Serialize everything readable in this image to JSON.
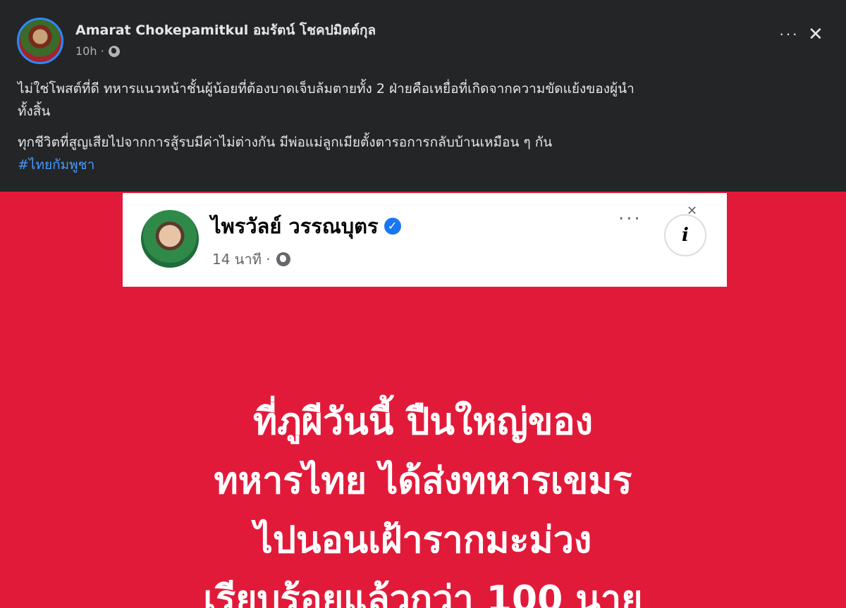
{
  "post": {
    "author": "Amarat Chokepamitkul อมรัตน์ โชคปมิตต์กุล",
    "time": "10h ·",
    "text_line1": "ไม่ใช่โพสต์ที่ดี ทหารแนวหน้าชั้นผู้น้อยที่ต้องบาดเจ็บล้มตายทั้ง 2 ฝ่ายคือเหยื่อที่เกิดจากความขัดแย้งของผู้นำ",
    "text_line2": "ทั้งสิ้น",
    "text_line3": "ทุกชีวิตที่สูญเสียไปจากการสู้รบมีค่าไม่ต่างกัน มีพ่อแม่ลูกเมียตั้งตารอการกลับบ้านเหมือน ๆ กัน",
    "hashtag": "#ไทยกัมพูชา",
    "more_label": "···",
    "close_label": "✕"
  },
  "quoted": {
    "author": "ไพรวัลย์ วรรณบุตร",
    "time": "14 นาที ·",
    "more_label": "···",
    "info_label": "i",
    "verified": "✓"
  },
  "image_text": [
    "ที่ภูผีวันนี้ ปืนใหญ่ของ",
    "ทหารไทย ได้ส่งทหารเขมร",
    "ไปนอนเฝ้ารากมะม่วง",
    "เรียบร้อยแล้วกว่า 100 นาย"
  ],
  "colors": {
    "background": "#242526",
    "image_background": "#e21a3a",
    "hashtag": "#4599ff"
  }
}
